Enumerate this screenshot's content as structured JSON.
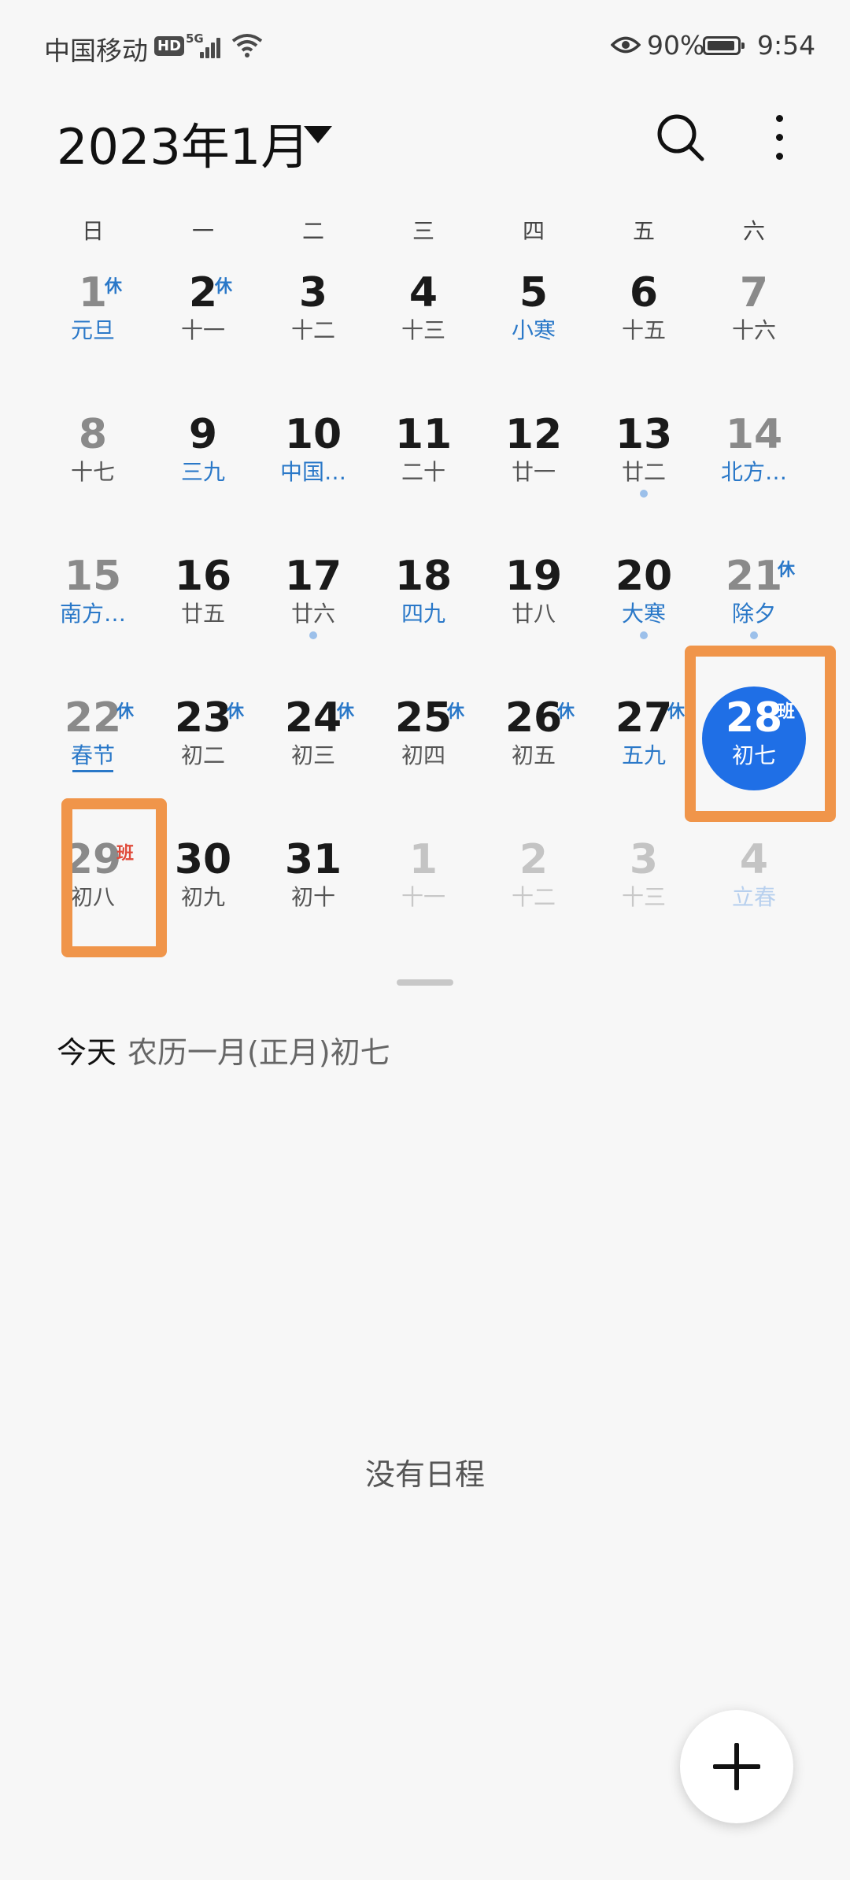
{
  "status_bar": {
    "carrier": "中国移动",
    "hd": "HD",
    "network": "5G",
    "battery_percent": "90%",
    "time": "9:54"
  },
  "header": {
    "title": "2023年1月"
  },
  "weekdays": [
    "日",
    "一",
    "二",
    "三",
    "四",
    "五",
    "六"
  ],
  "calendar": {
    "weeks": [
      [
        {
          "day": "1",
          "lunar": "元旦",
          "tag": "休",
          "festival": true,
          "weekend": true
        },
        {
          "day": "2",
          "lunar": "十一",
          "tag": "休"
        },
        {
          "day": "3",
          "lunar": "十二"
        },
        {
          "day": "4",
          "lunar": "十三"
        },
        {
          "day": "5",
          "lunar": "小寒",
          "festival": true
        },
        {
          "day": "6",
          "lunar": "十五"
        },
        {
          "day": "7",
          "lunar": "十六",
          "weekend": true
        }
      ],
      [
        {
          "day": "8",
          "lunar": "十七",
          "weekend": true
        },
        {
          "day": "9",
          "lunar": "三九",
          "festival": true
        },
        {
          "day": "10",
          "lunar": "中国…",
          "festival": true
        },
        {
          "day": "11",
          "lunar": "二十"
        },
        {
          "day": "12",
          "lunar": "廿一"
        },
        {
          "day": "13",
          "lunar": "廿二",
          "event": true
        },
        {
          "day": "14",
          "lunar": "北方…",
          "festival": true,
          "weekend": true
        }
      ],
      [
        {
          "day": "15",
          "lunar": "南方…",
          "festival": true,
          "weekend": true
        },
        {
          "day": "16",
          "lunar": "廿五"
        },
        {
          "day": "17",
          "lunar": "廿六",
          "event": true
        },
        {
          "day": "18",
          "lunar": "四九",
          "festival": true
        },
        {
          "day": "19",
          "lunar": "廿八"
        },
        {
          "day": "20",
          "lunar": "大寒",
          "festival": true,
          "event": true
        },
        {
          "day": "21",
          "lunar": "除夕",
          "tag": "休",
          "festival": true,
          "weekend": true,
          "event": true
        }
      ],
      [
        {
          "day": "22",
          "lunar": "春节",
          "tag": "休",
          "festival": true,
          "weekend": true,
          "underline": true
        },
        {
          "day": "23",
          "lunar": "初二",
          "tag": "休"
        },
        {
          "day": "24",
          "lunar": "初三",
          "tag": "休"
        },
        {
          "day": "25",
          "lunar": "初四",
          "tag": "休"
        },
        {
          "day": "26",
          "lunar": "初五",
          "tag": "休"
        },
        {
          "day": "27",
          "lunar": "五九",
          "tag": "休",
          "festival": true
        },
        {
          "day": "28",
          "lunar": "初七",
          "tag": "班",
          "today": true
        }
      ],
      [
        {
          "day": "29",
          "lunar": "初八",
          "tag": "班",
          "work": true,
          "weekend": true
        },
        {
          "day": "30",
          "lunar": "初九"
        },
        {
          "day": "31",
          "lunar": "初十"
        },
        {
          "day": "1",
          "lunar": "十一",
          "faded": true
        },
        {
          "day": "2",
          "lunar": "十二",
          "faded": true
        },
        {
          "day": "3",
          "lunar": "十三",
          "faded": true
        },
        {
          "day": "4",
          "lunar": "立春",
          "faded": true,
          "festival": true
        }
      ]
    ]
  },
  "today_info": {
    "label": "今天",
    "lunar": "农历一月(正月)初七"
  },
  "empty_message": "没有日程",
  "colors": {
    "accent": "#1f6fe6",
    "festival": "#2a78c8",
    "work_tag": "#e04a3a",
    "highlight": "#f0954a"
  }
}
